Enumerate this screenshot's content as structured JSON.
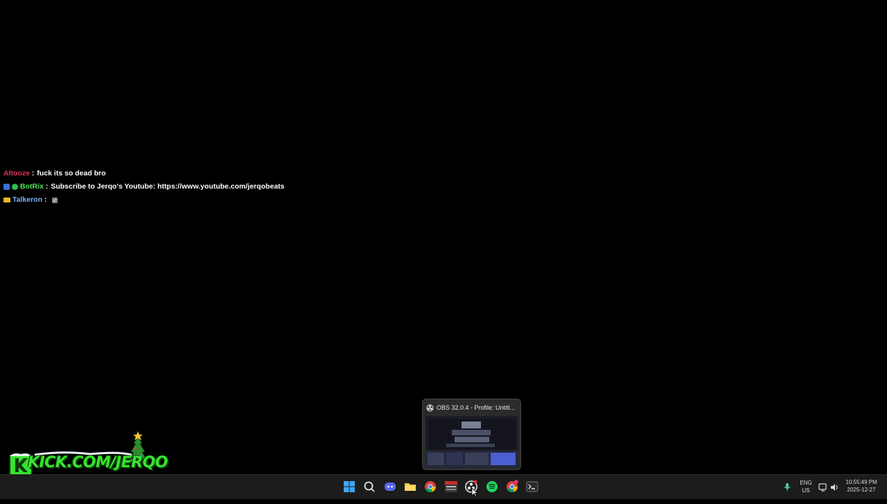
{
  "chat": {
    "messages": [
      {
        "username": "Altooze",
        "color": "#e0335b",
        "separator": ":",
        "text": "fuck its so dead bro",
        "badges": []
      },
      {
        "username": "BotRix",
        "color": "#50e35b",
        "separator": ":",
        "text": "Subscribe to Jerqo's Youtube: https://www.youtube.com/jerqobeats",
        "badges": [
          "bot-badge",
          "verified-badge"
        ]
      },
      {
        "username": "Talkeron",
        "color": "#7fb2ff",
        "separator": ":",
        "text": "",
        "badges": [
          "subscriber-badge"
        ],
        "emote": "emote-icon"
      }
    ]
  },
  "overlay": {
    "kick_text": "KICK.COM/JERQO"
  },
  "preview": {
    "title": "OBS 32.0.4 - Profile: Untitl..."
  },
  "taskbar": {
    "icons": [
      "start-icon",
      "search-icon",
      "discord-icon",
      "file-explorer-icon",
      "chrome-icon",
      "obs-app-icon",
      "obs-icon",
      "spotify-icon",
      "chrome-profile-icon",
      "terminal-icon"
    ],
    "language": {
      "line1": "ENG",
      "line2": "US"
    },
    "time": "10:55:49 PM",
    "date": "2025-12-27"
  },
  "colors": {
    "kick_green": "#37e32d",
    "taskbar_bg": "#1c1c1c"
  }
}
